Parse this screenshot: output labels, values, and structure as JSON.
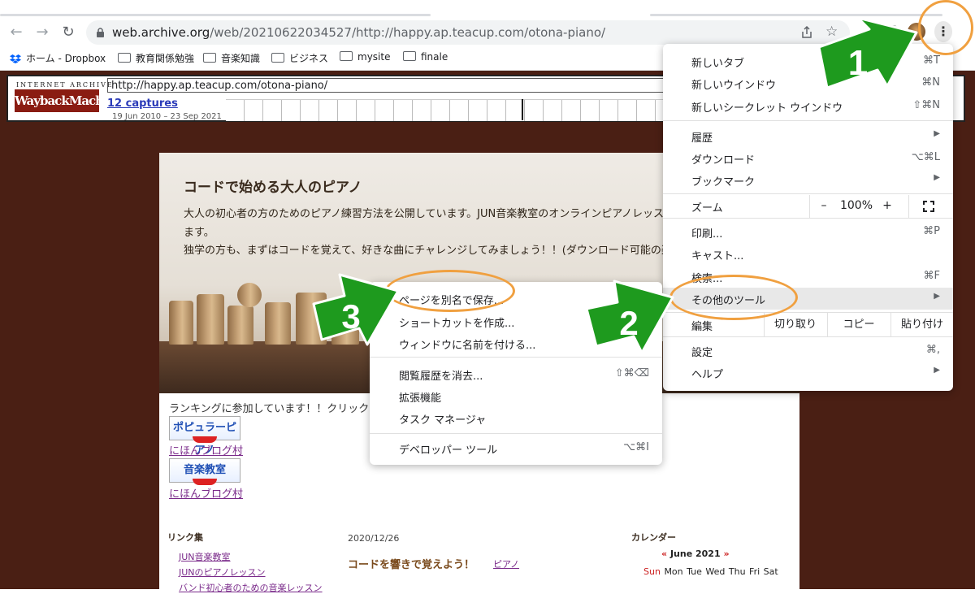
{
  "browser": {
    "url_host": "web.archive.org",
    "url_path": "/web/20210622034527/http://happy.ap.teacup.com/otona-piano/",
    "bookmarks": [
      {
        "label": "ホーム - Dropbox",
        "icon": "dropbox-icon"
      },
      {
        "label": "教育関係勉強",
        "icon": "folder-icon"
      },
      {
        "label": "音楽知識",
        "icon": "folder-icon"
      },
      {
        "label": "ビジネス",
        "icon": "folder-icon"
      },
      {
        "label": "mysite",
        "icon": "folder-icon"
      },
      {
        "label": "finale",
        "icon": "folder-icon"
      }
    ]
  },
  "wayback": {
    "logo_top": "INTERNET ARCHIVE",
    "logo": "WaybackMachine",
    "url": "http://happy.ap.teacup.com/otona-piano/",
    "captures": "12 captures",
    "dates": "19 Jun 2010 – 23 Sep 2021"
  },
  "site": {
    "title": "コードで始める大人のピアノ",
    "desc1": "大人の初心者の方のためのピアノ練習方法を公開しています。JUN音楽教室のオンラインピアノレッスン",
    "desc2": "ます。",
    "desc3": "独学の方も、まずはコードを覚えて、好きな曲にチャレンジしてみましょう！！(ダウンロード可能の楽",
    "ranking": "ランキングに参加しています！！クリックお",
    "badge1": "ポピュラーピアノ",
    "badge2": "音楽教室",
    "blog_link1": "にほんブログ村",
    "blog_link2": "にほんブログ村",
    "links_heading": "リンク集",
    "links": [
      "JUN音楽教室",
      "JUNのピアノレッスン",
      "バンド初心者のための音楽レッスン"
    ],
    "post_date": "2020/12/26",
    "post_title": "コードを響きで覚えよう！",
    "post_category": "ピアノ",
    "calendar_heading": "カレンダー",
    "calendar_prev": "«",
    "calendar_month": "June 2021",
    "calendar_next": "»",
    "calendar_sun": "Sun",
    "calendar_days": "Mon Tue Wed Thu Fri Sat"
  },
  "chrome_menu": {
    "new_tab": "新しいタブ",
    "new_tab_sc": "⌘T",
    "new_window": "新しいウインドウ",
    "new_window_sc": "⌘N",
    "new_incognito": "新しいシークレット ウインドウ",
    "new_incognito_sc": "⇧⌘N",
    "history": "履歴",
    "downloads": "ダウンロード",
    "downloads_sc": "⌥⌘L",
    "bookmarks": "ブックマーク",
    "zoom": "ズーム",
    "zoom_minus": "–",
    "zoom_value": "100%",
    "zoom_plus": "+",
    "print": "印刷...",
    "print_sc": "⌘P",
    "cast": "キャスト...",
    "find": "検索...",
    "find_sc": "⌘F",
    "more_tools": "その他のツール",
    "edit": "編集",
    "cut": "切り取り",
    "copy": "コピー",
    "paste": "貼り付け",
    "settings": "設定",
    "settings_sc": "⌘,",
    "help": "ヘルプ"
  },
  "submenu": {
    "save_page": "ページを別名で保存...",
    "create_shortcut": "ショートカットを作成...",
    "name_window": "ウィンドウに名前を付ける...",
    "clear_history": "閲覧履歴を消去...",
    "clear_history_sc": "⇧⌘⌫",
    "extensions": "拡張機能",
    "task_manager": "タスク マネージャ",
    "dev_tools": "デベロッパー ツール",
    "dev_tools_sc": "⌥⌘I"
  },
  "annotations": {
    "step1": "1",
    "step2": "2",
    "step3": "3"
  },
  "colors": {
    "arrow_green": "#1e9a1e",
    "ring_orange": "#f0a040",
    "page_bg": "#4a1f14"
  }
}
